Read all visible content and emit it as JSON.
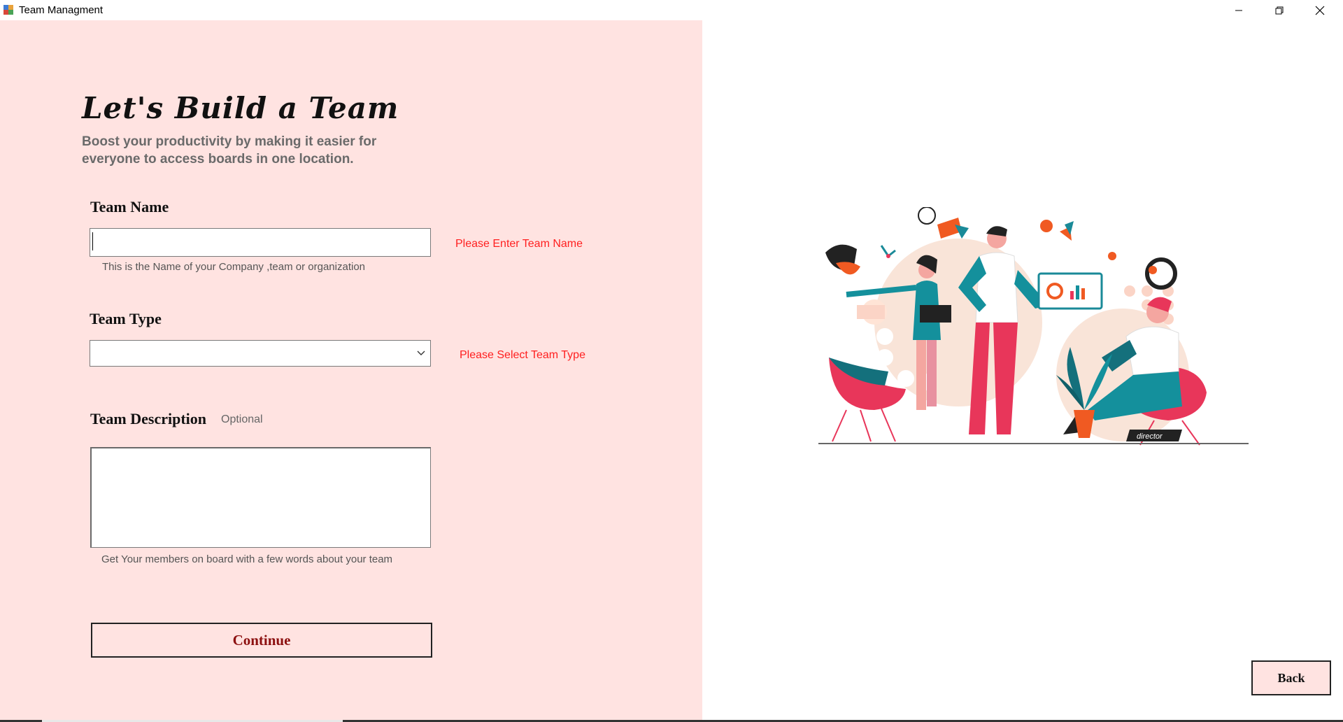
{
  "window": {
    "title": "Team Managment"
  },
  "form": {
    "heading": "Let's Build a Team",
    "subheading": "Boost your productivity by making it easier for everyone to access boards in one location.",
    "team_name": {
      "label": "Team Name",
      "value": "",
      "hint": "This is the Name of your Company ,team or organization",
      "error": "Please Enter Team Name"
    },
    "team_type": {
      "label": "Team Type",
      "selected": "",
      "error": "Please Select Team Type"
    },
    "team_description": {
      "label": "Team Description",
      "optional": "Optional",
      "value": "",
      "hint": "Get Your members on board with a few words about your team"
    },
    "continue_label": "Continue"
  },
  "back_label": "Back",
  "illustration": {
    "badge_text": "director"
  },
  "colors": {
    "pane_background": "#ffe3e1",
    "error_red": "#ff1f1f",
    "continue_text": "#8c1010",
    "teal": "#1a8a98",
    "pink": "#e8365a",
    "orange": "#f05a22",
    "peach": "#f7d8c8"
  }
}
